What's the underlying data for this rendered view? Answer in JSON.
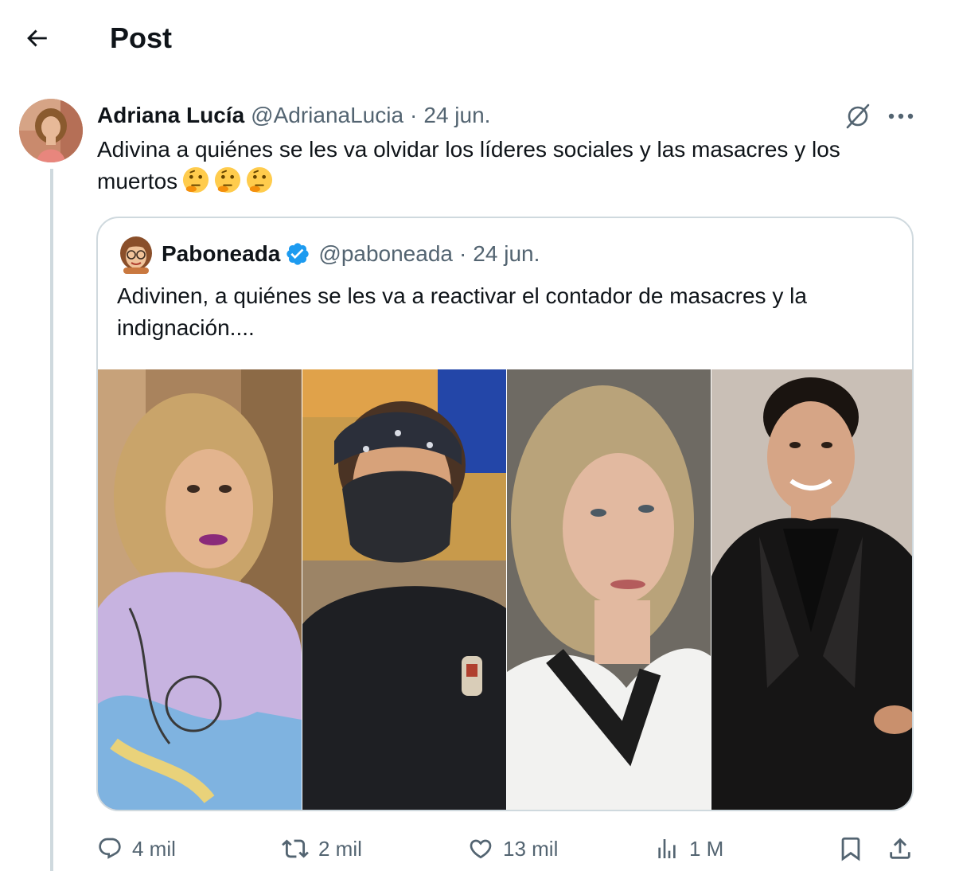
{
  "header": {
    "title": "Post",
    "back_icon": "arrow-left-icon"
  },
  "tweet": {
    "author_name": "Adriana Lucía",
    "author_handle": "@AdrianaLucia",
    "separator": "·",
    "date": "24 jun.",
    "text": "Adivina a quiénes se les va olvidar los líderes sociales y las masacres y los muertos",
    "emojis": [
      "thinking-face",
      "thinking-face",
      "thinking-face"
    ],
    "grok_icon": "grok-icon",
    "more_icon": "more-icon"
  },
  "quote": {
    "author_name": "Paboneada",
    "verified": true,
    "author_handle": "@paboneada",
    "separator": "·",
    "date": "24 jun.",
    "text": "Adivinen, a quiénes se les va a reactivar el contador de masacres y la indignación....",
    "media_count": 4
  },
  "actions": {
    "replies": "4 mil",
    "reposts": "2 mil",
    "likes": "13 mil",
    "views": "1 M",
    "bookmark_icon": "bookmark-icon",
    "share_icon": "share-icon"
  },
  "colors": {
    "text_primary": "#0f1419",
    "text_secondary": "#536471",
    "border": "#cfd9de",
    "verified_blue": "#1d9bf0"
  }
}
